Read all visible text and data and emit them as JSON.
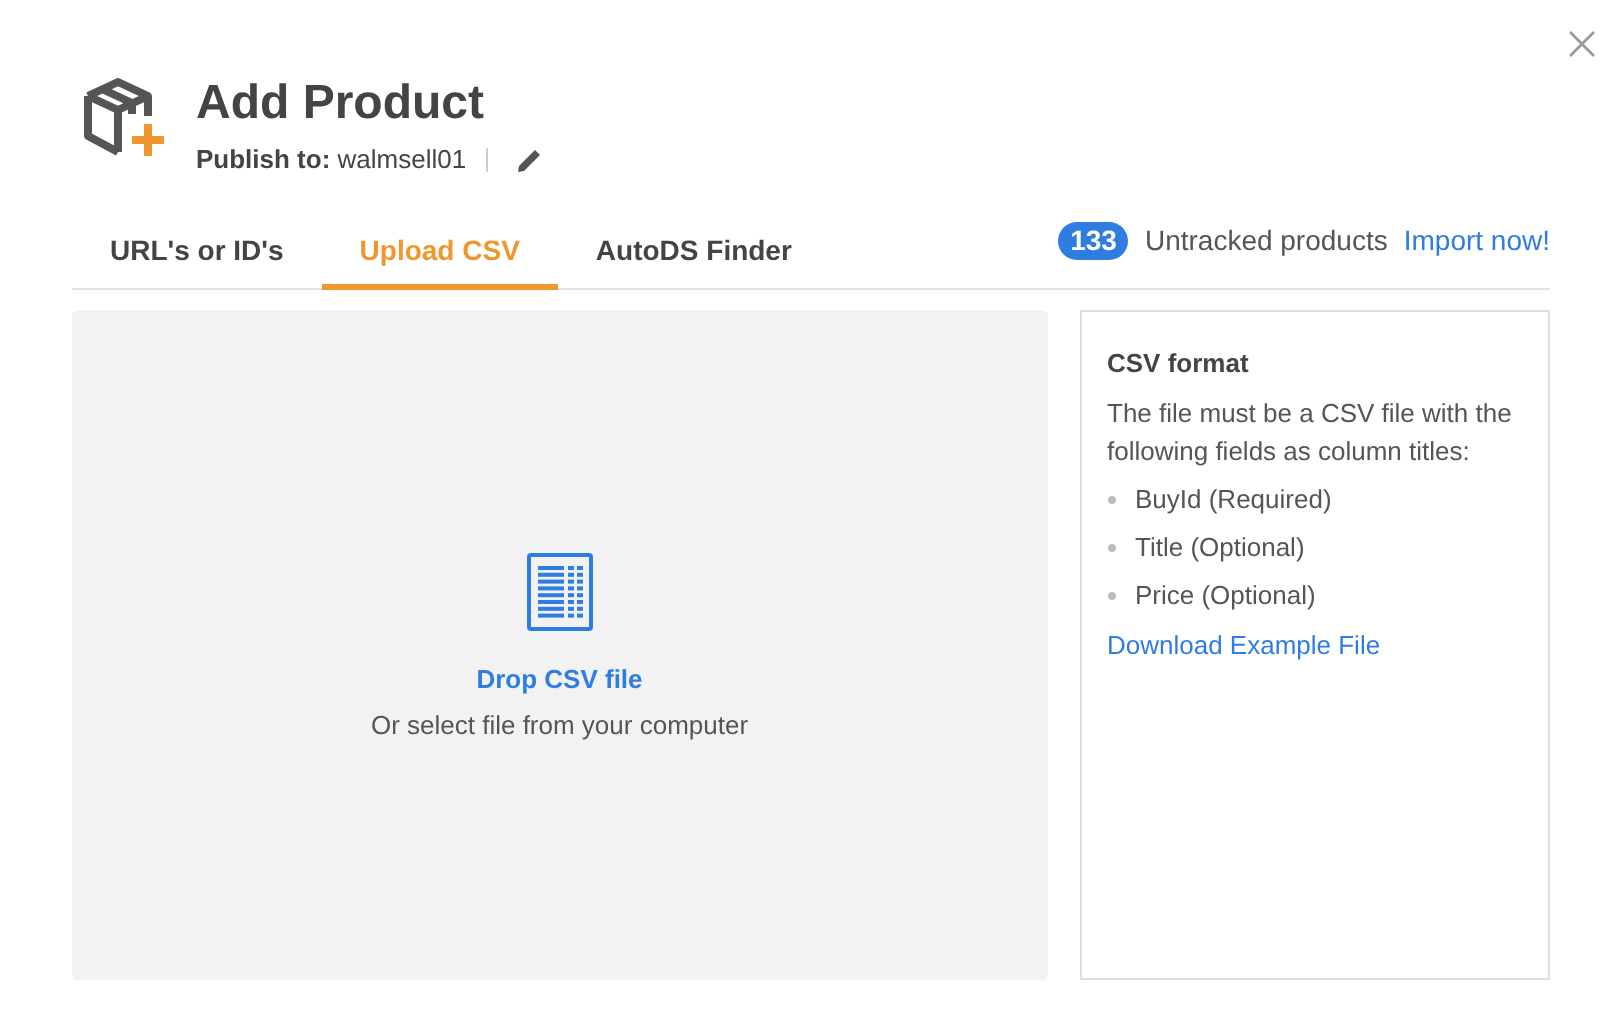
{
  "dialog": {
    "title": "Add Product",
    "publish_to": "**Publish to:** walmsell01"
  },
  "tabs": [
    {
      "label": "URL's or ID's",
      "selected": false
    },
    {
      "label": "Upload CSV",
      "selected": true
    },
    {
      "label": "AutoDS Finder",
      "selected": false
    }
  ],
  "untracked": {
    "count": "133",
    "label": "Untracked products",
    "link": "Import now!"
  },
  "dropzone": {
    "title": "Drop CSV file",
    "subtitle": "Or select file from your computer"
  },
  "format_panel": {
    "title": "CSV format",
    "description": "The file must be a CSV file with the following fields as column titles:",
    "fields": [
      "BuyId (Required)",
      "Title (Optional)",
      "Price (Optional)"
    ],
    "link": "Download Example File"
  }
}
